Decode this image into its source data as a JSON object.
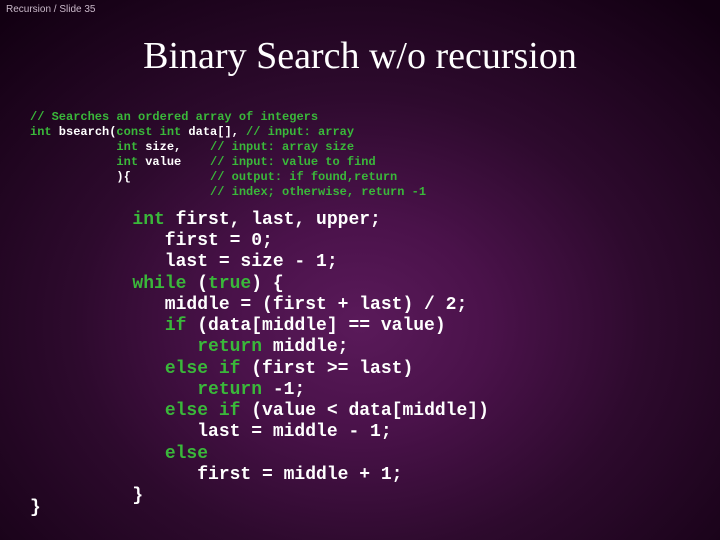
{
  "header": "Recursion / Slide 35",
  "title": "Binary Search w/o recursion",
  "sig": {
    "l1a": "// Searches an ordered array of integers",
    "l2a": "int",
    "l2b": " bsearch(",
    "l2c": "const int",
    "l2d": " data[], ",
    "l2e": "// input: array",
    "l3a": "            ",
    "l3b": "int",
    "l3c": " size,    ",
    "l3d": "// input: array size",
    "l4a": "            ",
    "l4b": "int",
    "l4c": " value    ",
    "l4d": "// input: value to find",
    "l5a": "            ){           ",
    "l5b": "// output: if found,return",
    "l6a": "                         ",
    "l6b": "// index; otherwise, return -1"
  },
  "body": {
    "l1a": "   ",
    "l1b": "int",
    "l1c": " first, last, upper;",
    "l2": "      first = 0;",
    "l3": "      last = size - 1;",
    "l4a": "   ",
    "l4b": "while",
    "l4c": " (",
    "l4d": "true",
    "l4e": ") {",
    "l5": "      middle = (first + last) / 2;",
    "l6a": "      ",
    "l6b": "if",
    "l6c": " (data[middle] == value)",
    "l7a": "         ",
    "l7b": "return",
    "l7c": " middle;",
    "l8a": "      ",
    "l8b": "else if",
    "l8c": " (first >= last)",
    "l9a": "         ",
    "l9b": "return",
    "l9c": " -1;",
    "l10a": "      ",
    "l10b": "else if",
    "l10c": " (value < data[middle])",
    "l11": "         last = middle - 1;",
    "l12a": "      ",
    "l12b": "else",
    "l13": "         first = middle + 1;",
    "l14": "   }"
  },
  "close": "}"
}
